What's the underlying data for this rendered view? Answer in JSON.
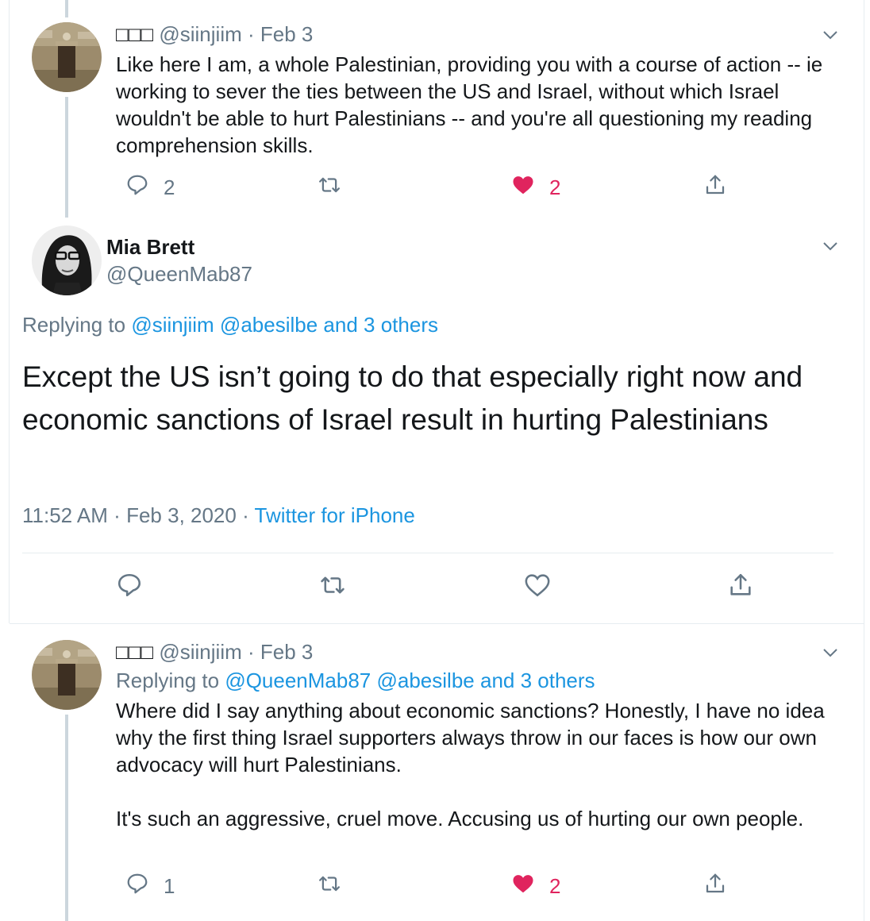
{
  "tweets": [
    {
      "display_name": "□□□",
      "handle": "@siinjiim",
      "sep": "·",
      "date": "Feb 3",
      "text": "Like here I am, a whole Palestinian, providing you with a course of action -- ie working to sever the ties between the US and Israel, without which Israel wouldn't be able to hurt Palestinians -- and you're all questioning my reading comprehension skills.",
      "reply_count": "2",
      "like_count": "2"
    },
    {
      "display_name": "□□□",
      "handle": "@siinjiim",
      "sep": "·",
      "date": "Feb 3",
      "replying_prefix": "Replying to",
      "replying_users": "@QueenMab87 @abesilbe",
      "replying_others": "and 3 others",
      "text": "Where did I say anything about economic sanctions? Honestly, I have no idea why the first thing Israel supporters always throw in our faces is how our own advocacy will hurt Palestinians.\n\nIt's such an aggressive, cruel move. Accusing us of hurting our own people.",
      "reply_count": "1",
      "like_count": "2"
    }
  ],
  "main_tweet": {
    "display_name": "Mia Brett",
    "handle": "@QueenMab87",
    "replying_prefix": "Replying to",
    "replying_users": "@siinjiim @abesilbe",
    "replying_others": "and 3 others",
    "text": "Except the US isn’t going to do that especially right now and economic sanctions of Israel result in hurting Palestinians",
    "time": "11:52 AM",
    "sep": "·",
    "date": "Feb 3, 2020",
    "source": "Twitter for iPhone"
  },
  "icons": {
    "reply": "reply-icon",
    "retweet": "retweet-icon",
    "like": "heart-icon",
    "share": "share-icon",
    "more": "chevron-down-icon"
  },
  "colors": {
    "link": "#1b95e0",
    "like": "#e0245e",
    "muted": "#657786",
    "text": "#14171a"
  }
}
